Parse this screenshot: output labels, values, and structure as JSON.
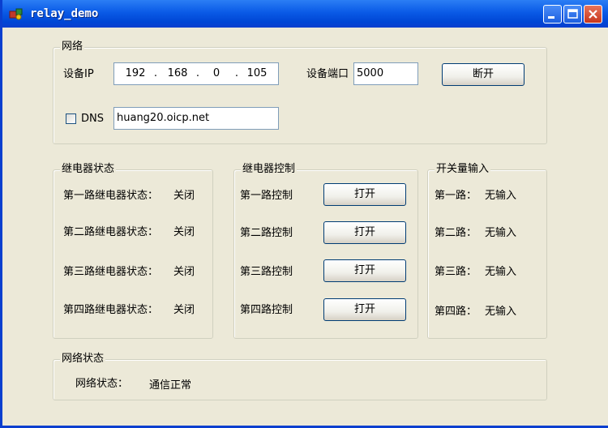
{
  "window": {
    "title": "relay_demo"
  },
  "network": {
    "group_title": "网络",
    "ip_label": "设备IP",
    "ip_octets": [
      "192",
      "168",
      "0",
      "105"
    ],
    "ip_dot": ".",
    "port_label": "设备端口",
    "port_value": "5000",
    "disconnect_label": "断开",
    "dns_label": "DNS",
    "dns_checked": false,
    "dns_value": "huang20.oicp.net"
  },
  "relay_status": {
    "group_title": "继电器状态",
    "rows": [
      {
        "label": "第一路继电器状态：",
        "value": "关闭"
      },
      {
        "label": "第二路继电器状态：",
        "value": "关闭"
      },
      {
        "label": "第三路继电器状态：",
        "value": "关闭"
      },
      {
        "label": "第四路继电器状态：",
        "value": "关闭"
      }
    ]
  },
  "relay_control": {
    "group_title": "继电器控制",
    "rows": [
      {
        "label": "第一路控制",
        "button": "打开"
      },
      {
        "label": "第二路控制",
        "button": "打开"
      },
      {
        "label": "第三路控制",
        "button": "打开"
      },
      {
        "label": "第四路控制",
        "button": "打开"
      }
    ]
  },
  "switch_input": {
    "group_title": "开关量输入",
    "rows": [
      {
        "label": "第一路：",
        "value": "无输入"
      },
      {
        "label": "第二路：",
        "value": "无输入"
      },
      {
        "label": "第三路：",
        "value": "无输入"
      },
      {
        "label": "第四路：",
        "value": "无输入"
      }
    ]
  },
  "net_status": {
    "group_title": "网络状态",
    "label": "网络状态：",
    "value": "通信正常"
  },
  "icons": {
    "app": "relay-app-icon",
    "minimize": "minimize-icon",
    "maximize": "maximize-icon",
    "close": "close-icon"
  }
}
